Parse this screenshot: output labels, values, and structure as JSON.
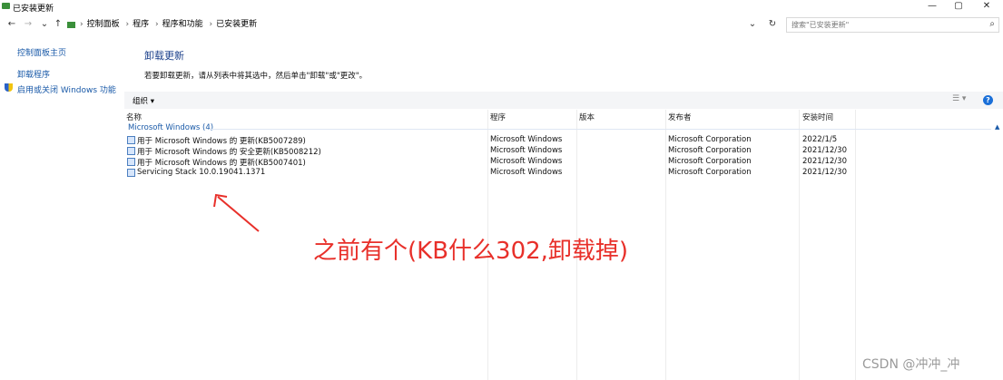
{
  "window": {
    "title": "已安装更新",
    "controls": {
      "minimize": "—",
      "maximize": "▢",
      "close": "✕"
    }
  },
  "address": {
    "back_icon": "←",
    "forward_icon": "→",
    "recent_icon": "⌄",
    "up_icon": "↑",
    "breadcrumb": [
      "控制面板",
      "程序",
      "程序和功能",
      "已安装更新"
    ],
    "dropdown_icon": "⌄",
    "refresh_icon": "↻",
    "search_placeholder": "搜索\"已安装更新\"",
    "search_icon": "⌕"
  },
  "sidebar": {
    "home": "控制面板主页",
    "uninstall": "卸载程序",
    "features": "启用或关闭 Windows 功能"
  },
  "main": {
    "title": "卸载更新",
    "description": "若要卸载更新，请从列表中将其选中，然后单击\"卸载\"或\"更改\"。"
  },
  "toolbar": {
    "organize": "组织 ▾",
    "view_icon": "☰ ▾",
    "help": "?"
  },
  "table": {
    "columns": [
      "名称",
      "程序",
      "版本",
      "发布者",
      "安装时间"
    ],
    "group_label": "Microsoft Windows (4)",
    "collapse_icon": "▲",
    "rows": [
      {
        "name": "用于 Microsoft Windows 的 更新(KB5007289)",
        "program": "Microsoft Windows",
        "version": "",
        "publisher": "Microsoft Corporation",
        "date": "2022/1/5"
      },
      {
        "name": "用于 Microsoft Windows 的 安全更新(KB5008212)",
        "program": "Microsoft Windows",
        "version": "",
        "publisher": "Microsoft Corporation",
        "date": "2021/12/30"
      },
      {
        "name": "用于 Microsoft Windows 的 更新(KB5007401)",
        "program": "Microsoft Windows",
        "version": "",
        "publisher": "Microsoft Corporation",
        "date": "2021/12/30"
      },
      {
        "name": "Servicing Stack 10.0.19041.1371",
        "program": "Microsoft Windows",
        "version": "",
        "publisher": "Microsoft Corporation",
        "date": "2021/12/30"
      }
    ]
  },
  "annotation": {
    "text": "之前有个(KB什么302,卸载掉)",
    "color": "#e8302a"
  },
  "watermark": "CSDN @冲冲_冲"
}
